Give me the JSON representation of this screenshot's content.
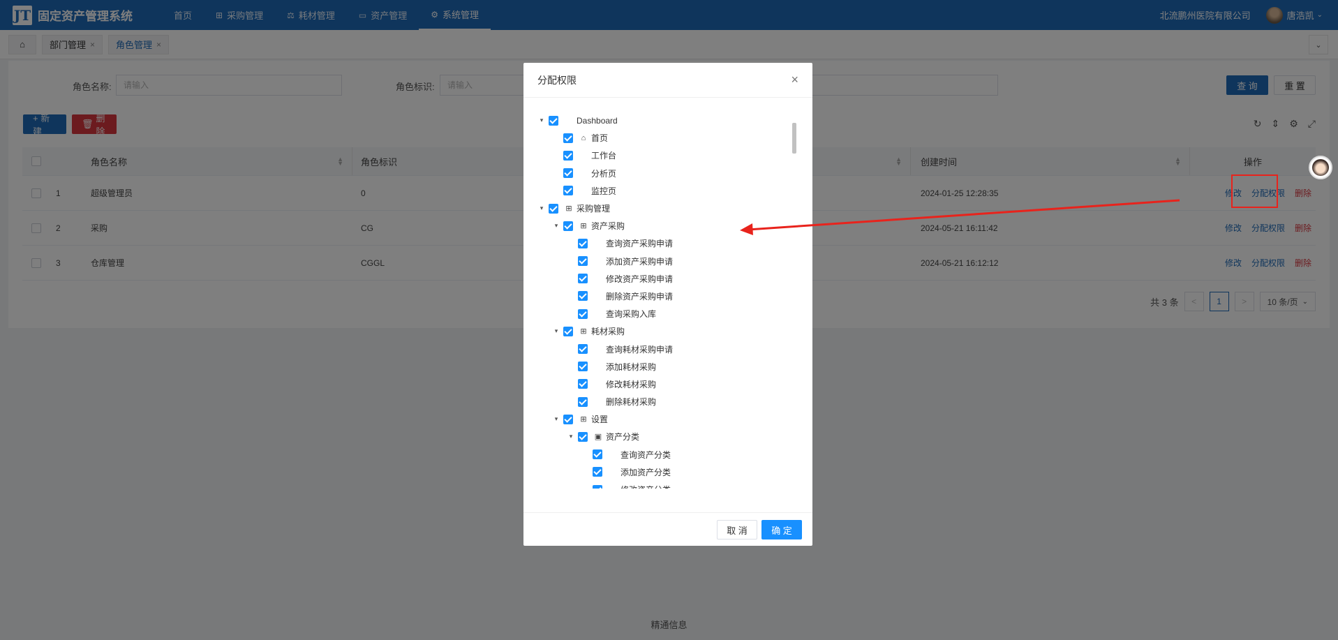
{
  "header": {
    "logo_mark": "JT",
    "app_title": "固定资产管理系统",
    "nav": [
      {
        "label": "首页",
        "icon": ""
      },
      {
        "label": "采购管理",
        "icon": "⊞"
      },
      {
        "label": "耗材管理",
        "icon": "⚖"
      },
      {
        "label": "资产管理",
        "icon": "▭"
      },
      {
        "label": "系统管理",
        "icon": "⚙"
      }
    ],
    "company": "北流鹏州医院有限公司",
    "username": "唐浩凯"
  },
  "tabs": {
    "home_icon": "⌂",
    "items": [
      {
        "label": "部门管理",
        "close": "×"
      },
      {
        "label": "角色管理",
        "close": "×"
      }
    ],
    "dropdown": "⌄"
  },
  "search": {
    "role_name_label": "角色名称:",
    "role_name_placeholder": "请输入",
    "role_key_label": "角色标识:",
    "role_key_placeholder": "请输入",
    "query_button": "查 询",
    "reset_button": "重 置"
  },
  "actions": {
    "new_button": "+ 新建",
    "delete_button": "删除"
  },
  "table": {
    "columns": [
      "角色名称",
      "角色标识",
      "创建时间",
      "操作"
    ],
    "rows": [
      {
        "index": "1",
        "name": "超级管理员",
        "key": "0",
        "created": "2024-01-25 12:28:35"
      },
      {
        "index": "2",
        "name": "采购",
        "key": "CG",
        "created": "2024-05-21 16:11:42"
      },
      {
        "index": "3",
        "name": "仓库管理",
        "key": "CGGL",
        "created": "2024-05-21 16:12:12"
      }
    ],
    "op_edit": "修改",
    "op_assign": "分配权限",
    "op_delete": "删除"
  },
  "pagination": {
    "total": "共 3 条",
    "prev": "<",
    "current": "1",
    "next": ">",
    "page_size": "10 条/页"
  },
  "footer": "精通信息",
  "dialog": {
    "title": "分配权限",
    "close": "×",
    "cancel": "取 消",
    "ok": "确 定",
    "tree": [
      {
        "label": "Dashboard",
        "level": 0,
        "arrow": true,
        "icon": ""
      },
      {
        "label": "首页",
        "level": 1,
        "arrow": false,
        "icon": "⌂"
      },
      {
        "label": "工作台",
        "level": 1,
        "arrow": false,
        "icon": ""
      },
      {
        "label": "分析页",
        "level": 1,
        "arrow": false,
        "icon": ""
      },
      {
        "label": "监控页",
        "level": 1,
        "arrow": false,
        "icon": ""
      },
      {
        "label": "采购管理",
        "level": 0,
        "arrow": true,
        "icon": "⊞"
      },
      {
        "label": "资产采购",
        "level": 1,
        "arrow": true,
        "icon": "⊞"
      },
      {
        "label": "查询资产采购申请",
        "level": 2,
        "arrow": false,
        "icon": ""
      },
      {
        "label": "添加资产采购申请",
        "level": 2,
        "arrow": false,
        "icon": ""
      },
      {
        "label": "修改资产采购申请",
        "level": 2,
        "arrow": false,
        "icon": ""
      },
      {
        "label": "删除资产采购申请",
        "level": 2,
        "arrow": false,
        "icon": ""
      },
      {
        "label": "查询采购入库",
        "level": 2,
        "arrow": false,
        "icon": ""
      },
      {
        "label": "耗材采购",
        "level": 1,
        "arrow": true,
        "icon": "⊞"
      },
      {
        "label": "查询耗材采购申请",
        "level": 2,
        "arrow": false,
        "icon": ""
      },
      {
        "label": "添加耗材采购",
        "level": 2,
        "arrow": false,
        "icon": ""
      },
      {
        "label": "修改耗材采购",
        "level": 2,
        "arrow": false,
        "icon": ""
      },
      {
        "label": "删除耗材采购",
        "level": 2,
        "arrow": false,
        "icon": ""
      },
      {
        "label": "设置",
        "level": 1,
        "arrow": true,
        "icon": "⊞"
      },
      {
        "label": "资产分类",
        "level": 2,
        "arrow": true,
        "icon": "▣"
      },
      {
        "label": "查询资产分类",
        "level": 3,
        "arrow": false,
        "icon": ""
      },
      {
        "label": "添加资产分类",
        "level": 3,
        "arrow": false,
        "icon": ""
      },
      {
        "label": "修改资产分类",
        "level": 3,
        "arrow": false,
        "icon": ""
      }
    ]
  },
  "colors": {
    "header_bg": "#1f6bb8",
    "primary": "#1890ff",
    "danger": "#d9363e",
    "annotation": "#e8231c"
  }
}
